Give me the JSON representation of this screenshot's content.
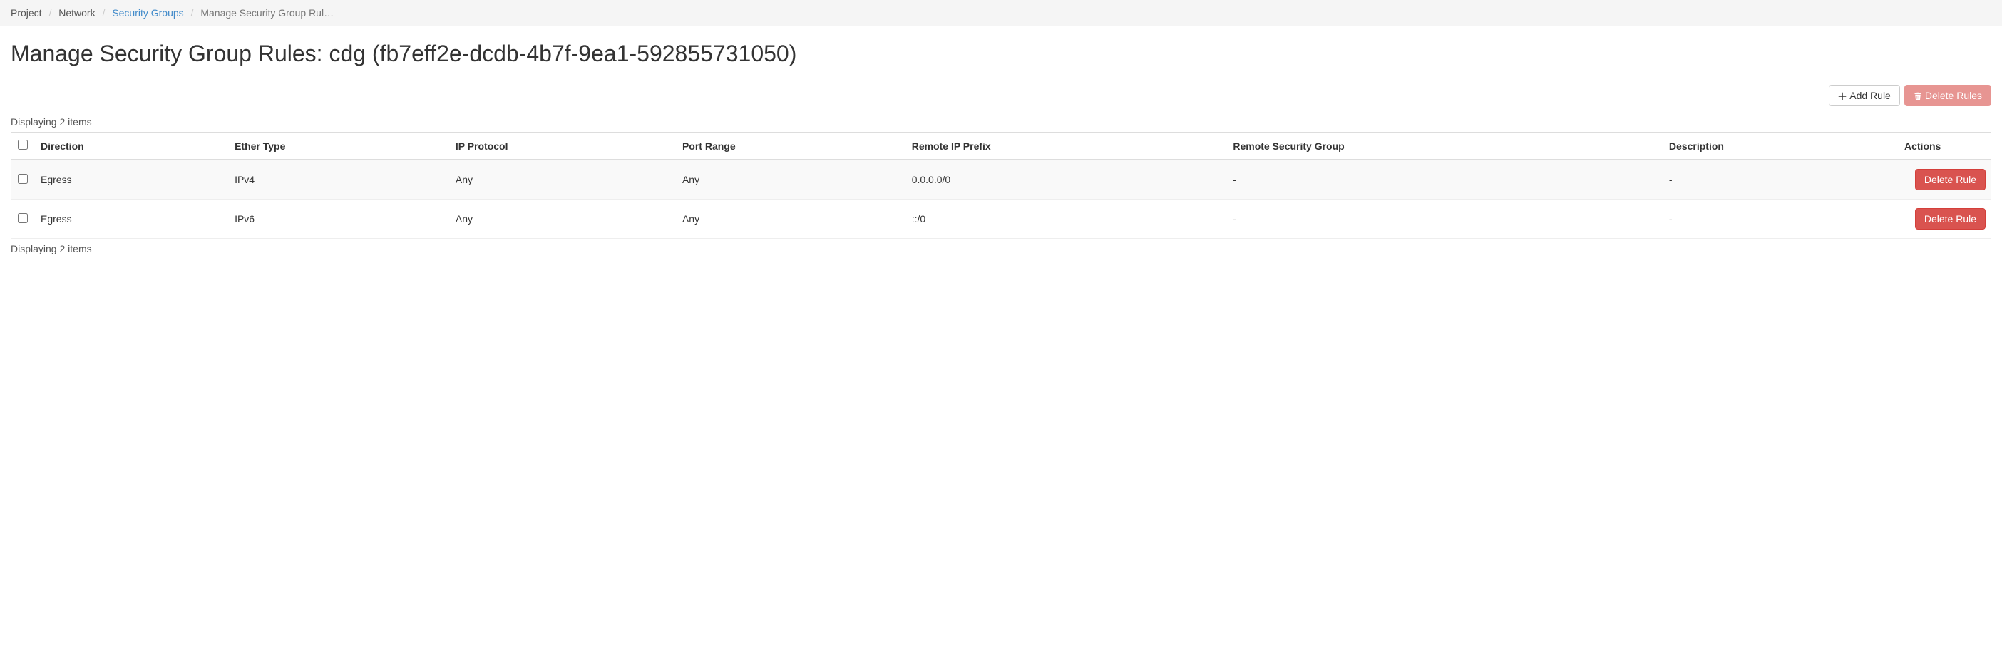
{
  "breadcrumb": {
    "items": [
      {
        "label": "Project",
        "link": false
      },
      {
        "label": "Network",
        "link": false
      },
      {
        "label": "Security Groups",
        "link": true
      },
      {
        "label": "Manage Security Group Rul…",
        "link": false,
        "active": true
      }
    ]
  },
  "page_title": "Manage Security Group Rules: cdg (fb7eff2e-dcdb-4b7f-9ea1-592855731050)",
  "toolbar": {
    "add_rule": "Add Rule",
    "delete_rules": "Delete Rules"
  },
  "item_count_top": "Displaying 2 items",
  "item_count_bottom": "Displaying 2 items",
  "table": {
    "columns": {
      "direction": "Direction",
      "ether_type": "Ether Type",
      "ip_protocol": "IP Protocol",
      "port_range": "Port Range",
      "remote_ip_prefix": "Remote IP Prefix",
      "remote_sg": "Remote Security Group",
      "description": "Description",
      "actions": "Actions"
    },
    "rows": [
      {
        "direction": "Egress",
        "ether_type": "IPv4",
        "ip_protocol": "Any",
        "port_range": "Any",
        "remote_ip_prefix": "0.0.0.0/0",
        "remote_sg": "-",
        "description": "-"
      },
      {
        "direction": "Egress",
        "ether_type": "IPv6",
        "ip_protocol": "Any",
        "port_range": "Any",
        "remote_ip_prefix": "::/0",
        "remote_sg": "-",
        "description": "-"
      }
    ],
    "row_action_label": "Delete Rule"
  }
}
